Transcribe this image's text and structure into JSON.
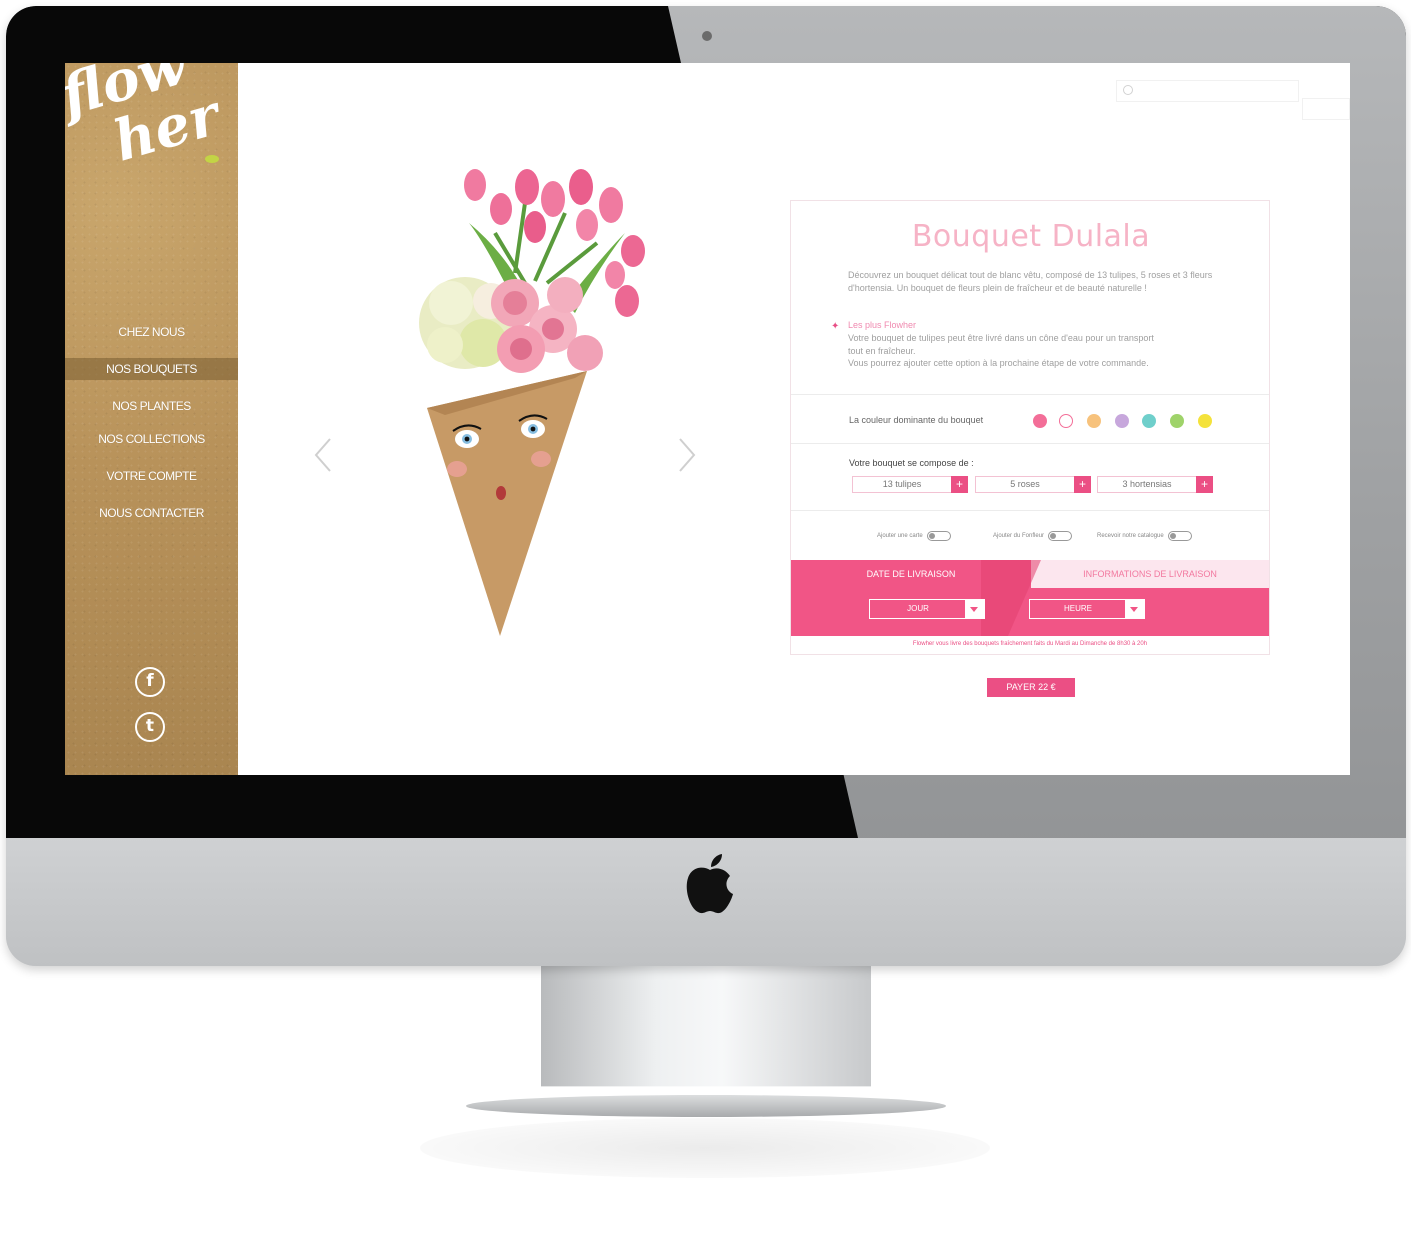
{
  "brand": {
    "logo_text_line1": "flow",
    "logo_text_line2": "her",
    "accent": "#eb4f84",
    "kraft": "#b8925a"
  },
  "nav": {
    "items": [
      {
        "label": "CHEZ NOUS",
        "active": false
      },
      {
        "label": "NOS BOUQUETS",
        "active": true
      },
      {
        "label": "NOS PLANTES",
        "active": false
      },
      {
        "label": "NOS COLLECTIONS",
        "active": false
      },
      {
        "label": "VOTRE COMPTE",
        "active": false
      },
      {
        "label": "NOUS CONTACTER",
        "active": false
      }
    ],
    "social": [
      {
        "icon": "facebook-icon",
        "glyph": "f"
      },
      {
        "icon": "twitter-icon",
        "glyph": "t"
      }
    ]
  },
  "search": {
    "placeholder": "",
    "button_label": ""
  },
  "product": {
    "title": "Bouquet Dulala",
    "description": "Découvrez un bouquet délicat tout de blanc vêtu, composé de 13 tulipes, 5 roses et 3 fleurs d'hortensia. Un bouquet de fleurs plein de fraîcheur et de beauté naturelle !",
    "plus_title": "Les plus Flowher",
    "plus_text_1": "Votre bouquet de tulipes peut être livré dans un cône d'eau pour un transport",
    "plus_text_2": "tout en fraîcheur.",
    "plus_text_3": "Vous pourrez ajouter cette option à la prochaine étape de votre commande.",
    "colors_label": "La couleur dominante du bouquet",
    "colors": [
      "#f36e98",
      "#ffffff",
      "#f7c27c",
      "#c7a7dc",
      "#6fcfcb",
      "#9fd36a",
      "#f4e23b"
    ],
    "compose_label": "Votre bouquet se compose de :",
    "components": [
      {
        "label": "13 tulipes",
        "plus": "+"
      },
      {
        "label": "5 roses",
        "plus": "+"
      },
      {
        "label": "3 hortensias",
        "plus": "+"
      }
    ],
    "options": [
      {
        "label": "Ajouter une carte"
      },
      {
        "label": "Ajouter du Fonfleur"
      },
      {
        "label": "Recevoir notre catalogue"
      }
    ],
    "tabs": [
      {
        "label": "DATE DE LIVRAISON"
      },
      {
        "label": "INFORMATIONS DE LIVRAISON"
      }
    ],
    "selects": [
      {
        "label": "JOUR"
      },
      {
        "label": "HEURE"
      }
    ],
    "delivery_note": "Flowher vous livre des bouquets fraîchement faits du Mardi au Dimanche de 8h30 à 20h",
    "pay_label": "PAYER 22 €"
  }
}
